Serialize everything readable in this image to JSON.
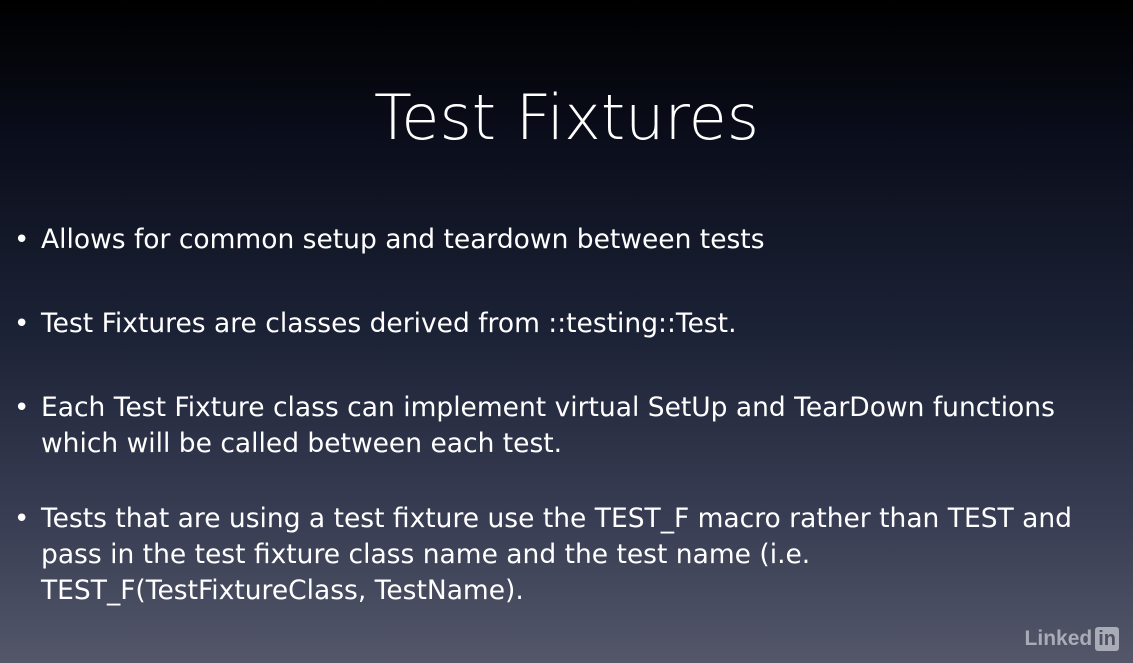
{
  "slide": {
    "title": "Test Fixtures",
    "bullets": [
      {
        "marker": "•",
        "text": "Allows for common setup and teardown between tests"
      },
      {
        "marker": "•",
        "text": "Test Fixtures are classes derived from ::testing::Test."
      },
      {
        "marker": "•",
        "text": "Each Test Fixture class can implement virtual SetUp and TearDown functions\nwhich will be called between each test."
      },
      {
        "marker": "•",
        "text": "Tests that are using a test fixture use the TEST_F macro rather than TEST and\npass in the test fixture class name and the test name (i.e.\nTEST_F(TestFixtureClass, TestName)."
      }
    ]
  },
  "watermark": {
    "word": "Linked",
    "box": "in"
  },
  "colors": {
    "background_top": "#000000",
    "background_bottom": "#545769",
    "text": "#ffffff",
    "watermark": "#b9bcc6"
  }
}
